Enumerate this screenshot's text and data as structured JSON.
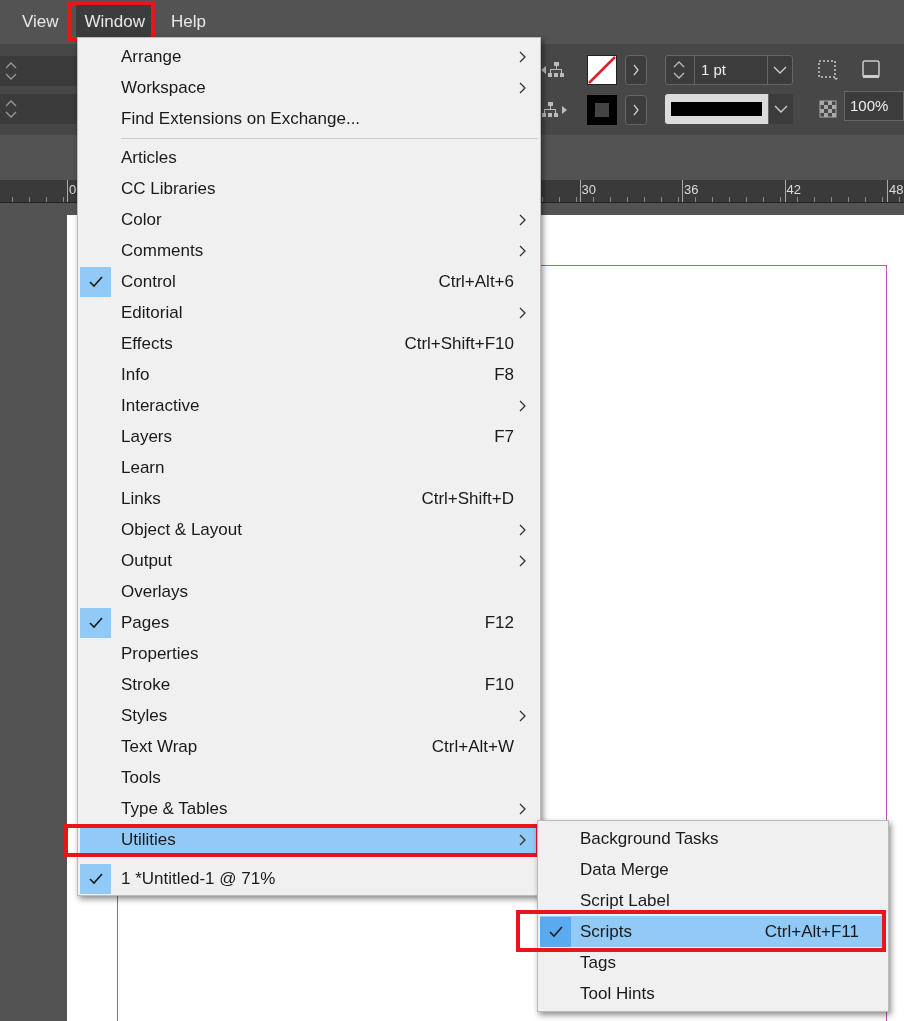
{
  "menubar": [
    {
      "label": "View",
      "selected": false,
      "highlighted": false
    },
    {
      "label": "Window",
      "selected": true,
      "highlighted": true
    },
    {
      "label": "Help",
      "selected": false,
      "highlighted": false
    }
  ],
  "control_panel": {
    "stroke_weight": "1 pt",
    "opacity": "100%"
  },
  "ruler": {
    "labels": [
      "0",
      "30",
      "36",
      "42",
      "48"
    ]
  },
  "window_menu": {
    "groups": [
      {
        "items": [
          {
            "label": "Arrange",
            "checked": false,
            "submenu": true,
            "selected": false,
            "highlighted": false
          },
          {
            "label": "Workspace",
            "checked": false,
            "submenu": true,
            "selected": false,
            "highlighted": false
          },
          {
            "label": "Find Extensions on Exchange...",
            "checked": false,
            "submenu": false,
            "selected": false,
            "highlighted": false
          }
        ]
      },
      {
        "divider": true,
        "items": [
          {
            "label": "Articles",
            "checked": false,
            "submenu": false,
            "selected": false,
            "highlighted": false
          },
          {
            "label": "CC Libraries",
            "checked": false,
            "submenu": false,
            "selected": false,
            "highlighted": false
          },
          {
            "label": "Color",
            "checked": false,
            "submenu": true,
            "selected": false,
            "highlighted": false
          },
          {
            "label": "Comments",
            "checked": false,
            "submenu": true,
            "selected": false,
            "highlighted": false
          },
          {
            "label": "Control",
            "shortcut": "Ctrl+Alt+6",
            "checked": true,
            "submenu": false,
            "selected": false,
            "highlighted": false
          },
          {
            "label": "Editorial",
            "checked": false,
            "submenu": true,
            "selected": false,
            "highlighted": false
          },
          {
            "label": "Effects",
            "shortcut": "Ctrl+Shift+F10",
            "checked": false,
            "submenu": false,
            "selected": false,
            "highlighted": false
          },
          {
            "label": "Info",
            "shortcut": "F8",
            "checked": false,
            "submenu": false,
            "selected": false,
            "highlighted": false
          },
          {
            "label": "Interactive",
            "checked": false,
            "submenu": true,
            "selected": false,
            "highlighted": false
          },
          {
            "label": "Layers",
            "shortcut": "F7",
            "checked": false,
            "submenu": false,
            "selected": false,
            "highlighted": false
          },
          {
            "label": "Learn",
            "checked": false,
            "submenu": false,
            "selected": false,
            "highlighted": false
          },
          {
            "label": "Links",
            "shortcut": "Ctrl+Shift+D",
            "checked": false,
            "submenu": false,
            "selected": false,
            "highlighted": false
          },
          {
            "label": "Object & Layout",
            "checked": false,
            "submenu": true,
            "selected": false,
            "highlighted": false
          },
          {
            "label": "Output",
            "checked": false,
            "submenu": true,
            "selected": false,
            "highlighted": false
          },
          {
            "label": "Overlays",
            "checked": false,
            "submenu": false,
            "selected": false,
            "highlighted": false
          },
          {
            "label": "Pages",
            "shortcut": "F12",
            "checked": true,
            "submenu": false,
            "selected": false,
            "highlighted": false
          },
          {
            "label": "Properties",
            "checked": false,
            "submenu": false,
            "selected": false,
            "highlighted": false
          },
          {
            "label": "Stroke",
            "shortcut": "F10",
            "checked": false,
            "submenu": false,
            "selected": false,
            "highlighted": false
          },
          {
            "label": "Styles",
            "checked": false,
            "submenu": true,
            "selected": false,
            "highlighted": false
          },
          {
            "label": "Text Wrap",
            "shortcut": "Ctrl+Alt+W",
            "checked": false,
            "submenu": false,
            "selected": false,
            "highlighted": false
          },
          {
            "label": "Tools",
            "checked": false,
            "submenu": false,
            "selected": false,
            "highlighted": false
          },
          {
            "label": "Type & Tables",
            "checked": false,
            "submenu": true,
            "selected": false,
            "highlighted": false
          },
          {
            "label": "Utilities",
            "checked": false,
            "submenu": true,
            "selected": true,
            "highlighted": true
          }
        ]
      },
      {
        "divider": false,
        "items": [
          {
            "label": "1 *Untitled-1 @ 71%",
            "checked": true,
            "submenu": false,
            "selected": false,
            "highlighted": false
          }
        ]
      }
    ]
  },
  "utilities_submenu": {
    "items": [
      {
        "label": "Background Tasks",
        "checked": false,
        "selected": false,
        "highlighted": false
      },
      {
        "label": "Data Merge",
        "checked": false,
        "selected": false,
        "highlighted": false
      },
      {
        "label": "Script Label",
        "checked": false,
        "selected": false,
        "highlighted": false
      },
      {
        "label": "Scripts",
        "shortcut": "Ctrl+Alt+F11",
        "checked": true,
        "selected": true,
        "highlighted": true
      },
      {
        "label": "Tags",
        "checked": false,
        "selected": false,
        "highlighted": false
      },
      {
        "label": "Tool Hints",
        "checked": false,
        "selected": false,
        "highlighted": false
      }
    ]
  }
}
